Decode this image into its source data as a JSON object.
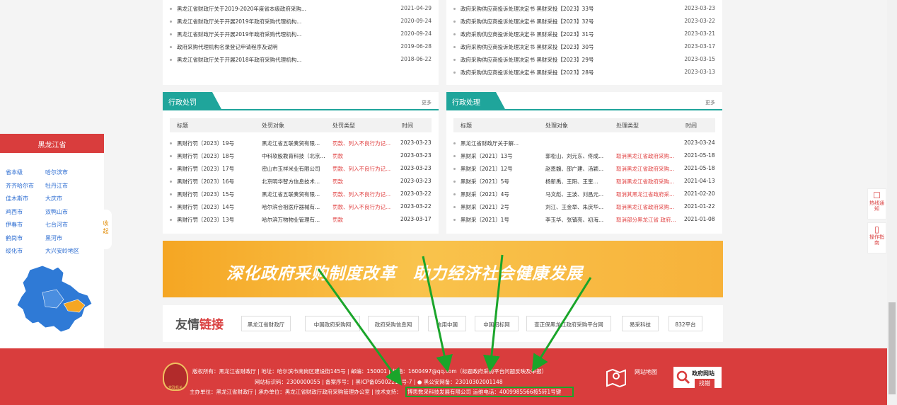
{
  "news_left": [
    {
      "title": "黑龙江省财政厅关于2019-2020年度省本级政府采购...",
      "date": "2021-04-29"
    },
    {
      "title": "黑龙江省财政厅关于开展2019年政府采购代理机构...",
      "date": "2020-09-24"
    },
    {
      "title": "黑龙江省财政厅关于开展2019年政府采购代理机构...",
      "date": "2020-09-24"
    },
    {
      "title": "政府采购代理机构名录登记申请程序及说明",
      "date": "2019-06-28"
    },
    {
      "title": "黑龙江省财政厅关于开展2018年政府采购代理机构...",
      "date": "2018-06-22"
    }
  ],
  "news_right": [
    {
      "title": "政府采购供应商投诉处理决定书 黑财采投【2023】33号",
      "date": "2023-03-23"
    },
    {
      "title": "政府采购供应商投诉处理决定书 黑财采投【2023】32号",
      "date": "2023-03-22"
    },
    {
      "title": "政府采购供应商投诉处理决定书 黑财采投【2023】31号",
      "date": "2023-03-21"
    },
    {
      "title": "政府采购供应商投诉处理决定书 黑财采投【2023】30号",
      "date": "2023-03-17"
    },
    {
      "title": "政府采购供应商投诉处理决定书 黑财采投【2023】29号",
      "date": "2023-03-15"
    },
    {
      "title": "政府采购供应商投诉处理决定书 黑财采投【2023】28号",
      "date": "2023-03-13"
    }
  ],
  "penalty": {
    "tab": "行政处罚",
    "more": "更多",
    "headers": [
      "标题",
      "处罚对象",
      "处罚类型",
      "时间"
    ],
    "rows": [
      [
        "黑财行罚〔2023〕19号",
        "黑龙江省五联奏贸有限...",
        "罚款、列入不良行为记...",
        "2023-03-23"
      ],
      [
        "黑财行罚〔2023〕18号",
        "中科软股教育科技（北京...",
        "罚款",
        "2023-03-23"
      ],
      [
        "黑财行罚〔2023〕17号",
        "密山市玉祥米业有限公司",
        "罚款、列入不良行为记...",
        "2023-03-23"
      ],
      [
        "黑财行罚〔2023〕16号",
        "北京明华智方信息技术...",
        "罚款",
        "2023-03-23"
      ],
      [
        "黑财行罚〔2023〕15号",
        "黑龙江省五联奏贸有限...",
        "罚款、列入不良行为记...",
        "2023-03-22"
      ],
      [
        "黑财行罚〔2023〕14号",
        "哈尔滨合祖医疗器械有...",
        "罚款、列入不良行为记...",
        "2023-03-22"
      ],
      [
        "黑财行罚〔2023〕13号",
        "哈尔滨万物物业管理有...",
        "罚款",
        "2023-03-17"
      ]
    ]
  },
  "handling": {
    "tab": "行政处理",
    "more": "更多",
    "headers": [
      "标题",
      "处理对象",
      "处理类型",
      "时间"
    ],
    "rows": [
      [
        "黑龙江省财政厅关于解...",
        "",
        "",
        "2023-03-24"
      ],
      [
        "黑财采〔2021〕13号",
        "郭松山、刘元东、佟成...",
        "取消黑龙江省政府采购...",
        "2021-05-18"
      ],
      [
        "黑财采〔2021〕12号",
        "赵恩魏、邵广建、汤颖...",
        "取消黑龙江省政府采购...",
        "2021-05-18"
      ],
      [
        "黑财采〔2021〕5号",
        "杨新禹、王阳、王奎...",
        "取消黑龙江省政府采购...",
        "2021-04-13"
      ],
      [
        "黑财采〔2021〕4号",
        "马文彪、王波、刘昌元...",
        "取消其黑龙江省政府采...",
        "2021-02-20"
      ],
      [
        "黑财采〔2021〕2号",
        "刘江、王金举、朱庆华...",
        "取消黑龙江省政府采购...",
        "2021-01-22"
      ],
      [
        "黑财采〔2021〕1号",
        "李玉华、张镇亮、初海...",
        "取消部分黑龙江省 政府...",
        "2021-01-08"
      ]
    ]
  },
  "sidebar": {
    "title": "黑龙江省",
    "cities": [
      "省本级",
      "哈尔滨市",
      "齐齐哈尔市",
      "牡丹江市",
      "佳木斯市",
      "大庆市",
      "鸡西市",
      "双鸭山市",
      "伊春市",
      "七台河市",
      "鹤岗市",
      "黑河市",
      "绥化市",
      "大兴安岭地区"
    ],
    "collapse_label": "收起"
  },
  "banner": {
    "text": "深化政府采购制度改革　助力经济社会健康发展"
  },
  "friend_links": {
    "title_a": "友情",
    "title_b": "链接",
    "items": [
      "黑龙江省财政厅",
      "中国政府采购网",
      "政府采购信息网",
      "信用中国",
      "中国招标网",
      "查正保黑龙江政府采购平台网",
      "易采科技",
      "832平台"
    ]
  },
  "footer": {
    "line1": "版权所有：黑龙江省财政厅 | 地址：哈尔滨市南岗区建设街145号 | 邮编：150001 | 邮箱：1600497@qq.com（标题政府采购平台问题反映及举报）",
    "line2": "网站标识码：2300000055 | 备案序号：| 黑ICP备05002215号-7 |",
    "line2b": "黑公安网备：23010302001148",
    "line3a": "主办单位：黑龙江省财政厅 | 承办单位：黑龙江省财政厅政府采购管理办公室 | 技术支持：",
    "line3b": "博思数采科技发展有限公司 运维电话：4009985566按5转1号键",
    "sitemap": "网站地图",
    "gov_title": "政府网站",
    "gov_sub": "找错",
    "badge_text": "党政机关"
  },
  "float_buttons": [
    {
      "label": "热线通知",
      "icon": "notice-icon"
    },
    {
      "label": "操作指南",
      "icon": "bookmark-icon"
    }
  ],
  "colors": {
    "primary_red": "#d93d3d",
    "teal": "#1fa59b",
    "annotation_green": "#1aa52a",
    "banner_orange": "#f5a623"
  }
}
